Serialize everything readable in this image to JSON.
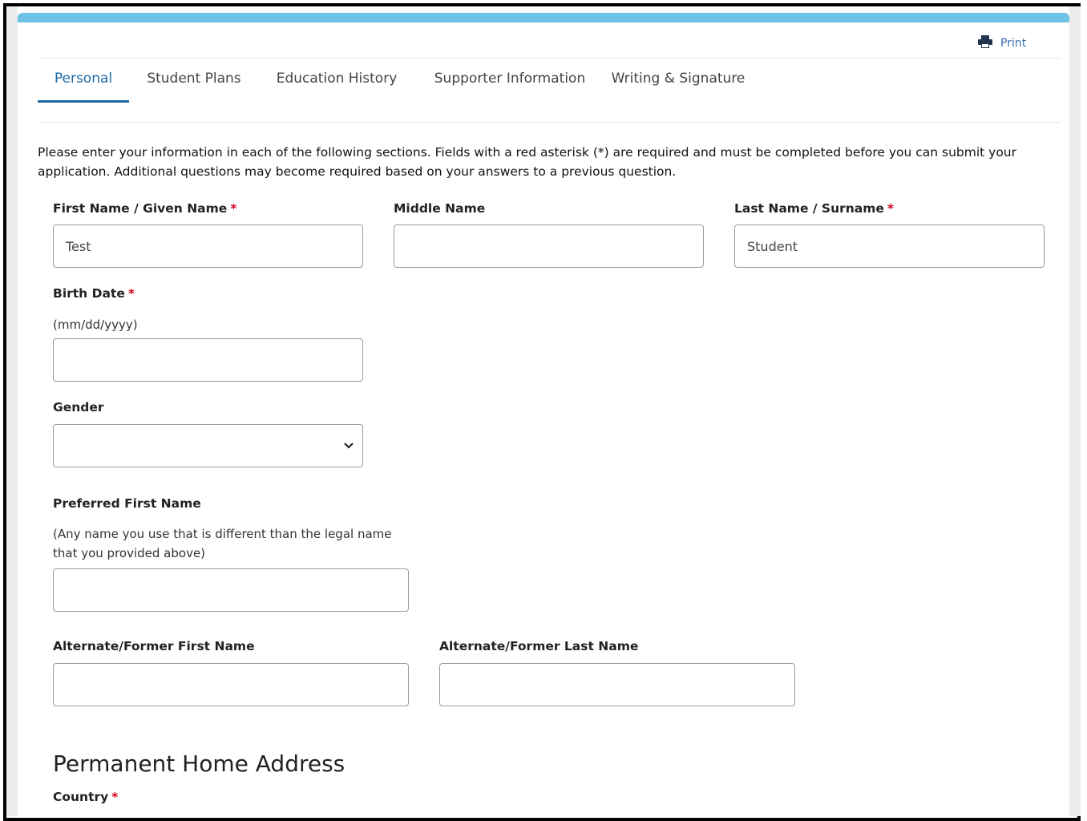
{
  "print": {
    "label": "Print",
    "icon": "printer-icon"
  },
  "tabs": [
    {
      "label": "Personal",
      "active": true
    },
    {
      "label": "Student Plans",
      "active": false
    },
    {
      "label": "Education History",
      "active": false
    },
    {
      "label": "Supporter Information",
      "active": false
    },
    {
      "label": "Writing & Signature",
      "active": false
    }
  ],
  "intro": "Please enter your information in each of the following sections. Fields with a red asterisk (*) are required and must be completed before you can submit your application. Additional questions may become required based on your answers to a previous question.",
  "required_marker": "*",
  "fields": {
    "first_name": {
      "label": "First Name / Given Name",
      "value": "Test",
      "required": true
    },
    "middle_name": {
      "label": "Middle Name",
      "value": "",
      "required": false
    },
    "last_name": {
      "label": "Last Name / Surname",
      "value": "Student",
      "required": true
    },
    "birth_date": {
      "label": "Birth Date",
      "hint": "(mm/dd/yyyy)",
      "value": "",
      "required": true
    },
    "gender": {
      "label": "Gender",
      "value": "",
      "required": false
    },
    "preferred_first_name": {
      "label": "Preferred First Name",
      "hint": "(Any name you use that is different than the legal name that you provided above)",
      "value": ""
    },
    "alt_first_name": {
      "label": "Alternate/Former First Name",
      "value": ""
    },
    "alt_last_name": {
      "label": "Alternate/Former Last Name",
      "value": ""
    }
  },
  "address_section": {
    "title": "Permanent Home Address",
    "country_label": "Country",
    "country_required": true
  },
  "colors": {
    "accent_bar": "#6ec2e4",
    "active_tab": "#1f6aa5",
    "required": "#d0021b",
    "link": "#3a6fb0"
  }
}
